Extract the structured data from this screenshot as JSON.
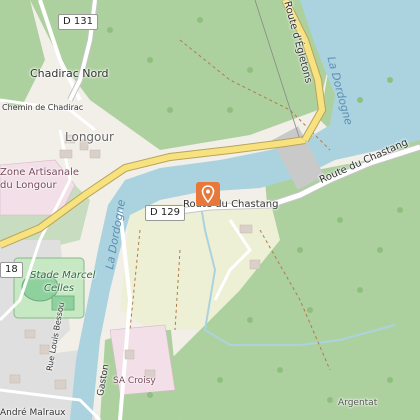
{
  "map": {
    "labels": {
      "chadirac_nord": "Chadirac Nord",
      "chemin_chadirac": "Chemin de Chadirac",
      "longour": "Longour",
      "zone_artisanale_1": "Zone Artisanale",
      "zone_artisanale_2": "du Longour",
      "stade_1": "Stade Marcel",
      "stade_2": "Celles",
      "sa_croisy": "SA Croisy",
      "argentat": "Argentat",
      "rue_louis": "Rue Louis Bessou",
      "andre_malraux": "André Malraux",
      "gaston": "Gaston",
      "route_chastang_1": "Route du Chastang",
      "route_chastang_2": "Route du Chastang",
      "route_egletons": "Route d'Égletons",
      "dordogne_1": "La Dordogne",
      "dordogne_2": "La Dordogne"
    },
    "roads": {
      "d131": "D 131",
      "d129": "D 129",
      "d18": "18"
    },
    "marker_icon": "location-pin-icon",
    "colors": {
      "water": "#aad3df",
      "forest": "#add19e",
      "road_major": "#f7e27f",
      "marker": "#e8783a"
    }
  }
}
